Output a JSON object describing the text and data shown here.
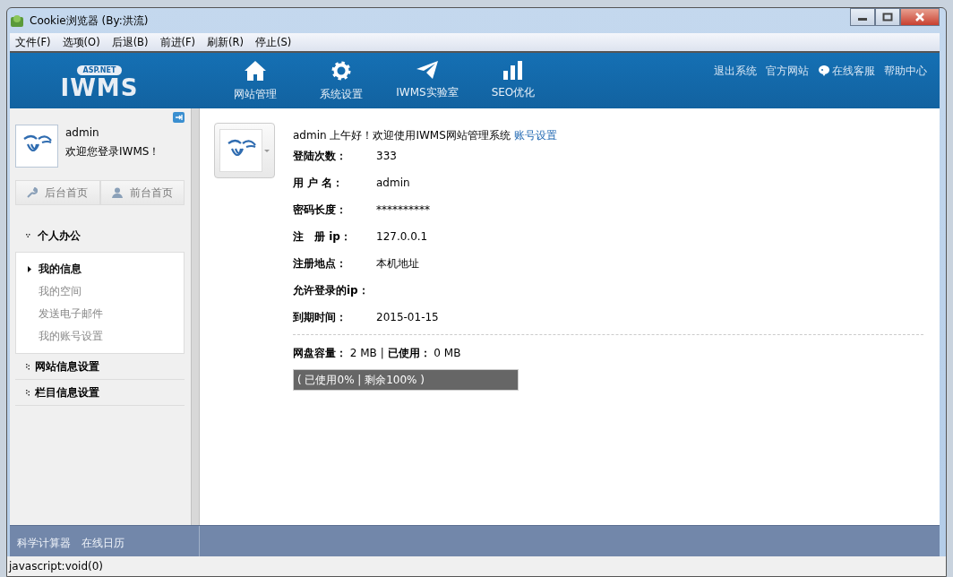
{
  "window": {
    "title": "Cookie浏览器 (By:洪流)"
  },
  "menu": [
    "文件(F)",
    "选项(O)",
    "后退(B)",
    "前进(F)",
    "刷新(R)",
    "停止(S)"
  ],
  "header": {
    "logo_badge": "ASP.NET",
    "logo": "IWMS",
    "nav": [
      "网站管理",
      "系统设置",
      "IWMS实验室",
      "SEO优化"
    ],
    "links": [
      "退出系统",
      "官方网站",
      "在线客服",
      "帮助中心"
    ]
  },
  "sidebar": {
    "user": "admin",
    "welcome": "欢迎您登录IWMS！",
    "buttons": [
      "后台首页",
      "前台首页"
    ],
    "groups": [
      {
        "label": "个人办公",
        "expanded": true,
        "items": [
          {
            "label": "我的信息",
            "selected": true
          },
          {
            "label": "我的空间",
            "selected": false
          },
          {
            "label": "发送电子邮件",
            "selected": false
          },
          {
            "label": "我的账号设置",
            "selected": false
          }
        ]
      },
      {
        "label": "网站信息设置",
        "expanded": false
      },
      {
        "label": "栏目信息设置",
        "expanded": false
      }
    ]
  },
  "main": {
    "greeting": "admin 上午好！欢迎使用IWMS网站管理系统",
    "account_link": "账号设置",
    "fields": [
      {
        "label": "登陆次数：",
        "value": "333"
      },
      {
        "label": "用 户 名：",
        "value": "admin"
      },
      {
        "label": "密码长度：",
        "value": "**********"
      },
      {
        "label": "注　册 ip：",
        "value": "127.0.0.1"
      },
      {
        "label": "注册地点：",
        "value": "本机地址"
      },
      {
        "label": "允许登录的ip："
      },
      {
        "label": "到期时间：",
        "value": "2015-01-15"
      }
    ],
    "disk": "**网盘容量：** 2 MB | **已使用：** 0 MB",
    "usage": "( 已使用0% | 剩余100% )"
  },
  "footer": [
    "科学计算器",
    "在线日历"
  ],
  "status_bar": "javascript:void(0)"
}
